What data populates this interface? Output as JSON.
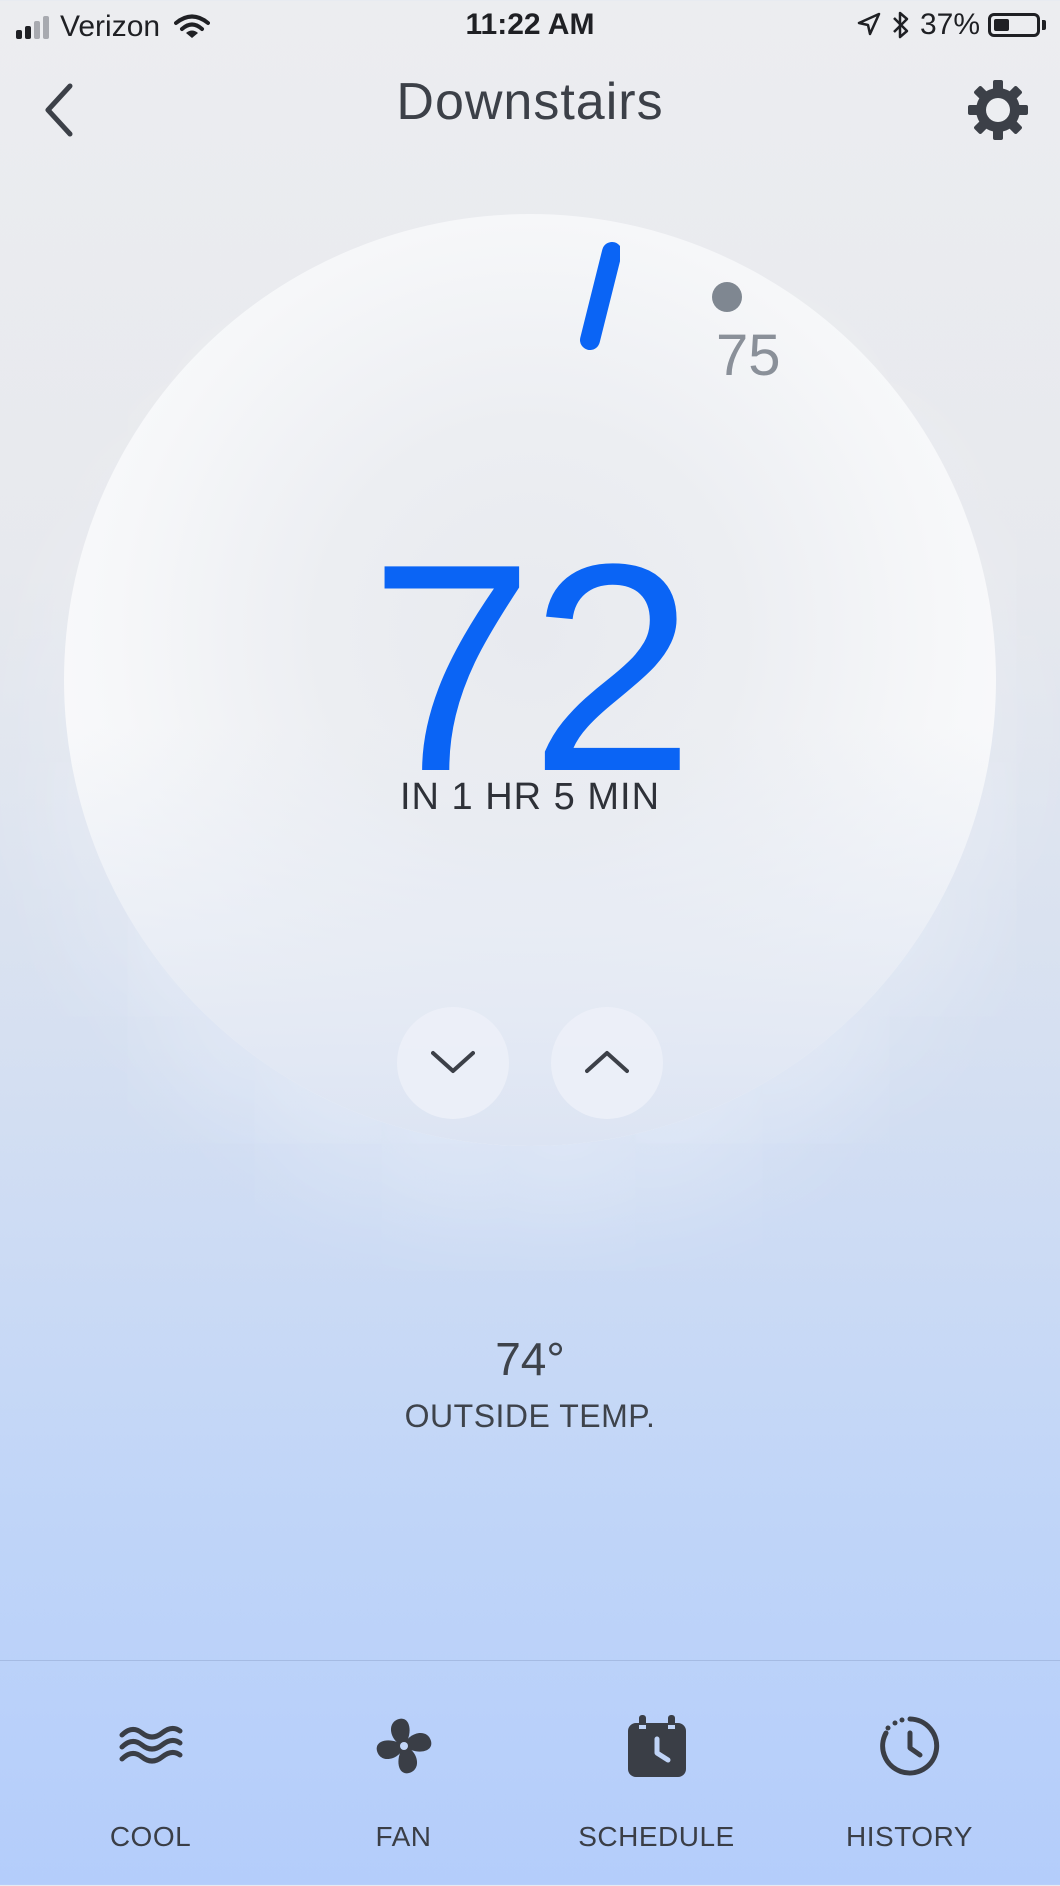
{
  "status_bar": {
    "carrier": "Verizon",
    "time": "11:22 AM",
    "battery_percent": "37%",
    "battery_level": 0.37
  },
  "header": {
    "title": "Downstairs"
  },
  "thermostat": {
    "target_temp": "72",
    "current_temp": "75",
    "eta": "IN 1 HR 5 MIN",
    "accent_color": "#0a64f5"
  },
  "outside": {
    "temp": "74°",
    "label": "OUTSIDE TEMP."
  },
  "tabs": [
    {
      "label": "COOL",
      "icon": "wave-icon"
    },
    {
      "label": "FAN",
      "icon": "fan-icon"
    },
    {
      "label": "SCHEDULE",
      "icon": "calendar-clock-icon"
    },
    {
      "label": "HISTORY",
      "icon": "history-icon"
    }
  ]
}
